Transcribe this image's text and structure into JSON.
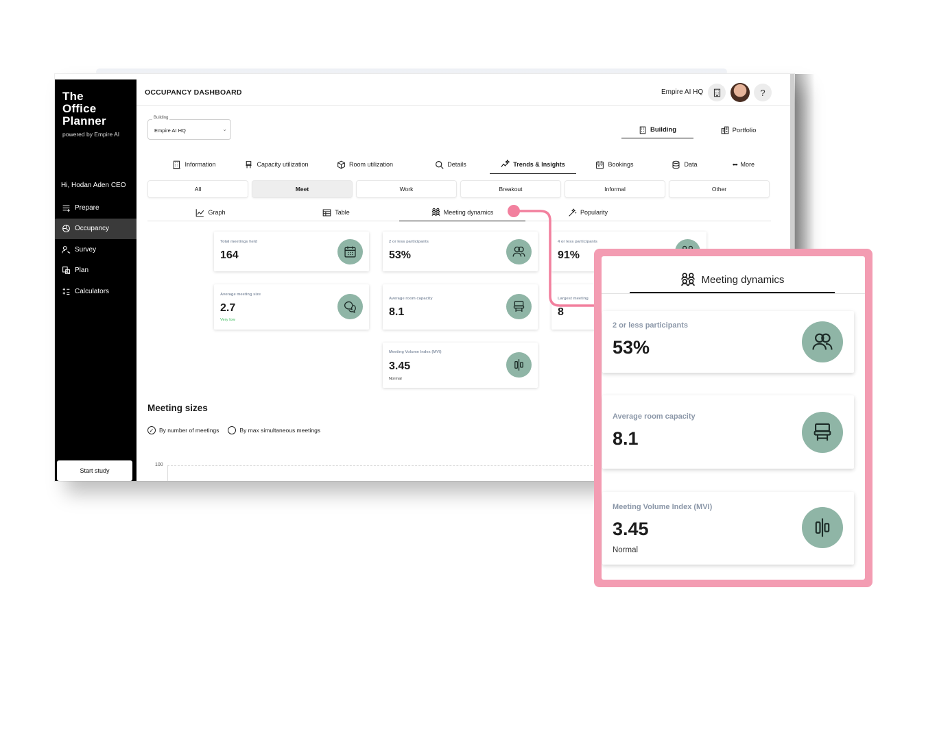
{
  "app": {
    "brand_line1": "The",
    "brand_line2": "Office",
    "brand_line3": "Planner",
    "brand_sub": "powered by Empire AI",
    "greeting": "Hi, Hodan Aden CEO",
    "start_study": "Start study"
  },
  "sidebar": {
    "items": [
      {
        "label": "Prepare",
        "icon": "list-plus-icon"
      },
      {
        "label": "Occupancy",
        "icon": "chart-pie-icon"
      },
      {
        "label": "Survey",
        "icon": "user-search-icon"
      },
      {
        "label": "Plan",
        "icon": "floor-plan-icon"
      },
      {
        "label": "Calculators",
        "icon": "calculator-icon"
      }
    ],
    "active_item": "Occupancy"
  },
  "header": {
    "title": "OCCUPANCY DASHBOARD",
    "location": "Empire AI HQ",
    "help": "?"
  },
  "building_select": {
    "label": "Building",
    "value": "Empire AI HQ"
  },
  "scope": {
    "building": "Building",
    "portfolio": "Portfolio",
    "active": "Building"
  },
  "tabs": [
    {
      "label": "Information"
    },
    {
      "label": "Capacity utilization"
    },
    {
      "label": "Room utilization"
    },
    {
      "label": "Details"
    },
    {
      "label": "Trends & Insights"
    },
    {
      "label": "Bookings"
    },
    {
      "label": "Data"
    },
    {
      "label": "More"
    }
  ],
  "active_tab": "Trends & Insights",
  "space_types": [
    "All",
    "Meet",
    "Work",
    "Breakout",
    "Informal",
    "Other"
  ],
  "active_space_type": "Meet",
  "views": [
    {
      "label": "Graph"
    },
    {
      "label": "Table"
    },
    {
      "label": "Meeting dynamics"
    },
    {
      "label": "Popularity"
    }
  ],
  "active_view": "Meeting dynamics",
  "cards": {
    "total_meetings": {
      "label": "Total meetings held",
      "value": "164"
    },
    "two_or_less": {
      "label": "2 or less participants",
      "value": "53%"
    },
    "four_or_less": {
      "label": "4 or less participants",
      "value": "91%"
    },
    "avg_meeting_size": {
      "label": "Average meeting size",
      "value": "2.7",
      "sub": "Very low"
    },
    "avg_room_capacity": {
      "label": "Average room capacity",
      "value": "8.1"
    },
    "largest_meeting": {
      "label": "Largest meeting",
      "value": "8"
    },
    "mvi": {
      "label": "Meeting Volume Index (MVI)",
      "value": "3.45",
      "sub": "Normal"
    }
  },
  "meeting_sizes": {
    "title": "Meeting sizes",
    "option_1": "By number of meetings",
    "option_2": "By max simultaneous meetings",
    "selected": "By number of meetings",
    "y_tick_top": "100"
  },
  "zoom": {
    "tab_label": "Meeting dynamics"
  },
  "colors": {
    "accent_pink": "#f39cb2",
    "icon_bg": "#8fb5a6",
    "sidebar_bg": "#000000",
    "very_low": "#3bbb5c"
  }
}
